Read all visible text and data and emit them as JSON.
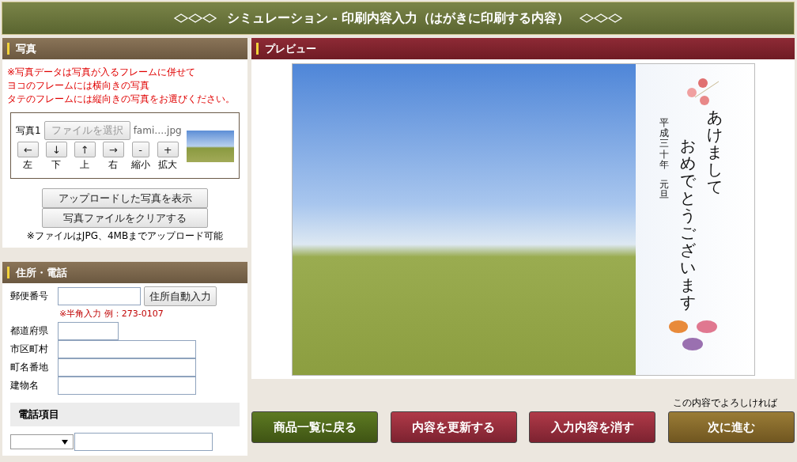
{
  "header": {
    "title": "シミュレーション - 印刷内容入力（はがきに印刷する内容）"
  },
  "photo_panel": {
    "title": "写真",
    "notes": [
      "※写真データは写真が入るフレームに併せて",
      "ヨコのフレームには横向きの写真",
      "タテのフレームには縦向きの写真をお選びください。"
    ],
    "slot": {
      "label": "写真1",
      "file_button": "ファイルを選択",
      "file_name": "fami….jpg",
      "disabled": true,
      "moves": [
        {
          "symbol": "←",
          "caption": "左"
        },
        {
          "symbol": "↓",
          "caption": "下"
        },
        {
          "symbol": "↑",
          "caption": "上"
        },
        {
          "symbol": "→",
          "caption": "右"
        },
        {
          "symbol": "-",
          "caption": "縮小"
        },
        {
          "symbol": "+",
          "caption": "拡大"
        }
      ]
    },
    "buttons": [
      "アップロードした写真を表示",
      "写真ファイルをクリアする"
    ],
    "footnote": "※ファイルはJPG、4MBまでアップロード可能"
  },
  "address_panel": {
    "title": "住所・電話",
    "postal": {
      "label": "郵便番号",
      "button": "住所自動入力",
      "hint": "※半角入力 例：273-0107"
    },
    "fields": [
      {
        "label": "都道府県",
        "kind": "short"
      },
      {
        "label": "市区町村",
        "kind": "long"
      },
      {
        "label": "町名番地",
        "kind": "long"
      },
      {
        "label": "建物名",
        "kind": "long"
      }
    ],
    "phone_heading": "電話項目"
  },
  "preview": {
    "title": "プレビュー",
    "greeting": [
      "あけまして",
      "おめでとうございます"
    ],
    "date": [
      "平成三十年",
      "元旦"
    ]
  },
  "confirm_note": "この内容でよろしければ",
  "actions": [
    {
      "label": "商品一覧に戻る",
      "kind": "back"
    },
    {
      "label": "内容を更新する",
      "kind": "update"
    },
    {
      "label": "入力内容を消す",
      "kind": "clear"
    },
    {
      "label": "次に進む",
      "kind": "next"
    }
  ]
}
